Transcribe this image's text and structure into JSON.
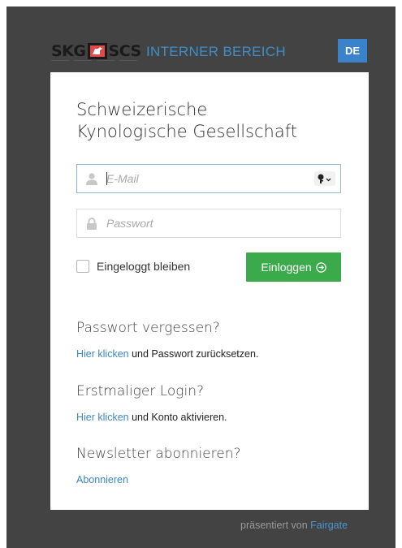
{
  "header": {
    "logo_left": "SKG",
    "logo_right": "SCS",
    "area_title": "INTERNER BEREICH",
    "language": "DE"
  },
  "card": {
    "org_name_line1": "Schweizerische",
    "org_name_line2": "Kynologische Gesellschaft",
    "email": {
      "placeholder": "E-Mail",
      "value": "",
      "icon": "user-icon",
      "addon_icon": "key-icon"
    },
    "password": {
      "placeholder": "Passwort",
      "value": "",
      "icon": "lock-icon"
    },
    "remember_label": "Eingeloggt bleiben",
    "remember_checked": false,
    "login_label": "Einloggen",
    "forgot": {
      "title": "Passwort vergessen?",
      "link": "Hier klicken",
      "rest": " und Passwort zurücksetzen."
    },
    "first_login": {
      "title": "Erstmaliger Login?",
      "link": "Hier klicken",
      "rest": " und Konto aktivieren."
    },
    "newsletter": {
      "title": "Newsletter abonnieren?",
      "link": "Abonnieren"
    }
  },
  "footer": {
    "text": "präsentiert von ",
    "link": "Fairgate"
  },
  "colors": {
    "background": "#434343",
    "accent_blue": "#3a82c9",
    "login_green": "#3aaa4a",
    "link_blue": "#3a86c4"
  }
}
